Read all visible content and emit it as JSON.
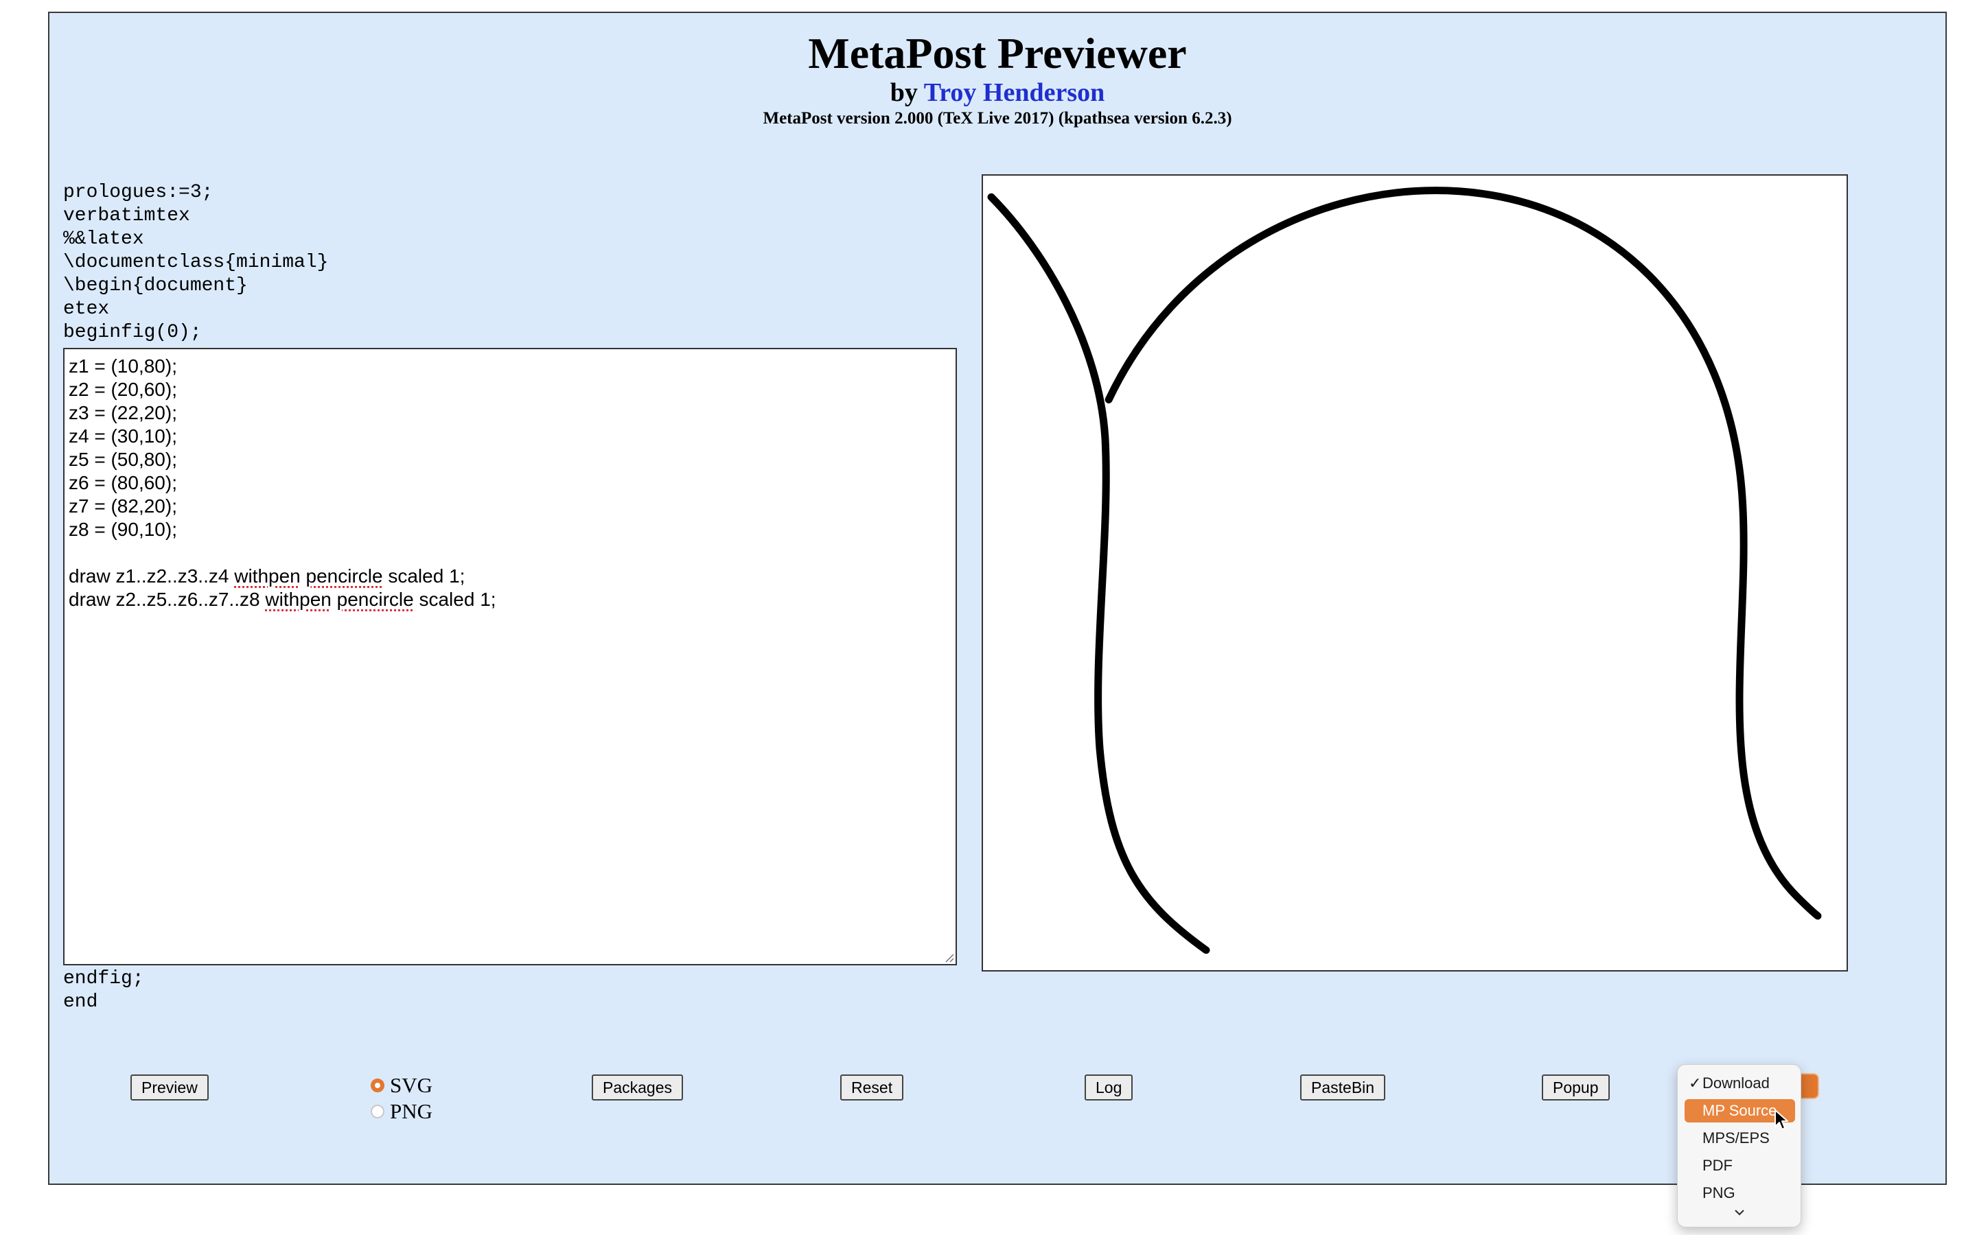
{
  "header": {
    "title": "MetaPost Previewer",
    "by_prefix": "by",
    "author": "Troy Henderson",
    "version": "MetaPost version 2.000 (TeX Live 2017) (kpathsea version 6.2.3)"
  },
  "prologue": "prologues:=3;\nverbatimtex\n%&latex\n\\documentclass{minimal}\n\\begin{document}\netex\nbeginfig(0);",
  "editor": {
    "lines": [
      "z1 = (10,80);",
      "z2 = (20,60);",
      "z3 = (22,20);",
      "z4 = (30,10);",
      "z5 = (50,80);",
      "z6 = (80,60);",
      "z7 = (82,20);",
      "z8 = (90,10);",
      "",
      "draw z1..z2..z3..z4 withpen pencircle scaled 1;",
      "draw z2..z5..z6..z7..z8 withpen pencircle scaled 1;"
    ],
    "misspelled_words": [
      "withpen",
      "pencircle"
    ]
  },
  "epilogue": "endfig;\nend",
  "toolbar": {
    "preview": "Preview",
    "format_svg": "SVG",
    "format_png": "PNG",
    "selected_format": "SVG",
    "packages": "Packages",
    "reset": "Reset",
    "log": "Log",
    "pastebin": "PasteBin",
    "popup": "Popup"
  },
  "download_menu": {
    "options": [
      "Download",
      "MP Source",
      "MPS/EPS",
      "PDF",
      "PNG"
    ],
    "checked": "Download",
    "highlighted": "MP Source"
  },
  "colors": {
    "page_bg": "#dbeafb",
    "accent": "#e2772e",
    "author_link": "#1f2fcf"
  }
}
